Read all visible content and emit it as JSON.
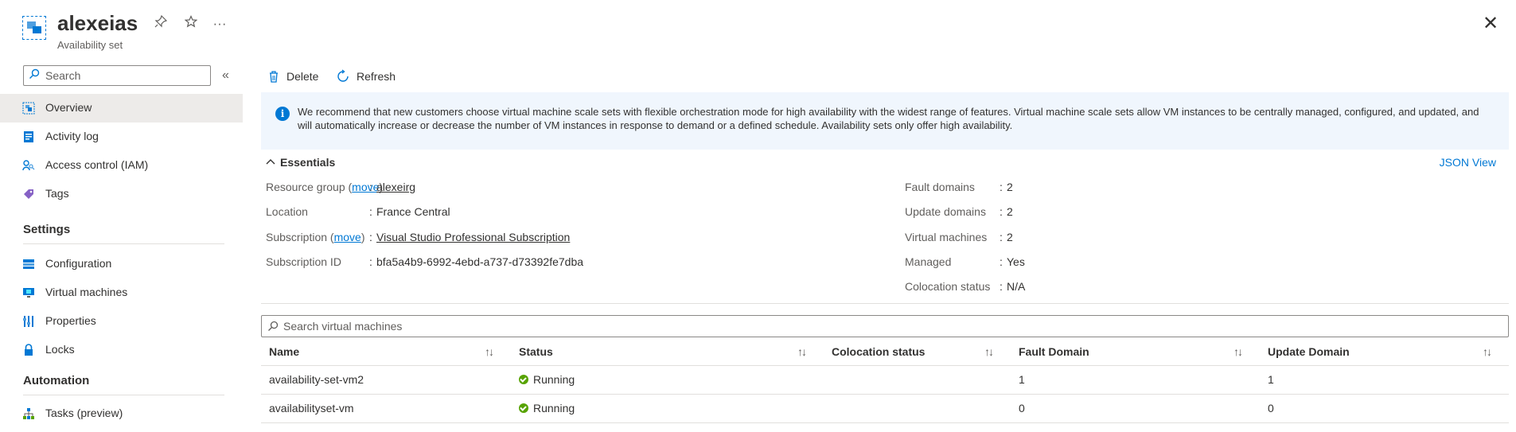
{
  "header": {
    "title": "alexeias",
    "subtitle": "Availability set",
    "pin_icon": "pin-icon",
    "favorite_icon": "star-icon",
    "more_label": "···",
    "close_label": "✕"
  },
  "sidebar": {
    "search_placeholder": "Search",
    "collapse_label": "«",
    "items": [
      {
        "label": "Overview",
        "icon": "overview-icon"
      },
      {
        "label": "Activity log",
        "icon": "activity-log-icon"
      },
      {
        "label": "Access control (IAM)",
        "icon": "iam-icon"
      },
      {
        "label": "Tags",
        "icon": "tag-icon"
      }
    ],
    "settings_header": "Settings",
    "settings_items": [
      {
        "label": "Configuration",
        "icon": "configuration-icon"
      },
      {
        "label": "Virtual machines",
        "icon": "virtual-machine-icon"
      },
      {
        "label": "Properties",
        "icon": "properties-icon"
      },
      {
        "label": "Locks",
        "icon": "lock-icon"
      }
    ],
    "automation_header": "Automation",
    "automation_items": [
      {
        "label": "Tasks (preview)",
        "icon": "tasks-icon"
      }
    ]
  },
  "toolbar": {
    "delete_label": "Delete",
    "refresh_label": "Refresh"
  },
  "banner": {
    "text": "We recommend that new customers choose virtual machine scale sets with flexible orchestration mode for high availability with the widest range of features. Virtual machine scale sets allow VM instances to be centrally managed, configured, and updated, and will automatically increase or decrease the number of VM instances in response to demand or a defined schedule. Availability sets only offer high availability."
  },
  "essentials": {
    "toggle_label": "Essentials",
    "json_view_label": "JSON View",
    "move_label": "move",
    "left": {
      "resource_group_label": "Resource group (",
      "resource_group_label_end": ")",
      "resource_group_value": "alexeirg",
      "location_label": "Location",
      "location_value": "France Central",
      "subscription_label": "Subscription (",
      "subscription_label_end": ")",
      "subscription_value": "Visual Studio Professional Subscription",
      "subscription_id_label": "Subscription ID",
      "subscription_id_value": "bfa5a4b9-6992-4ebd-a737-d73392fe7dba"
    },
    "right": {
      "fault_domains_label": "Fault domains",
      "fault_domains_value": "2",
      "update_domains_label": "Update domains",
      "update_domains_value": "2",
      "virtual_machines_label": "Virtual machines",
      "virtual_machines_value": "2",
      "managed_label": "Managed",
      "managed_value": "Yes",
      "colocation_label": "Colocation status",
      "colocation_value": "N/A"
    },
    "separator": ":"
  },
  "vm_search": {
    "placeholder": "Search virtual machines"
  },
  "table": {
    "sort_label": "↑↓",
    "columns": [
      "Name",
      "Status",
      "Colocation status",
      "Fault Domain",
      "Update Domain"
    ],
    "rows": [
      {
        "name": "availability-set-vm2",
        "status": "Running",
        "colocation": "",
        "fault_domain": "1",
        "update_domain": "1"
      },
      {
        "name": "availabilityset-vm",
        "status": "Running",
        "colocation": "",
        "fault_domain": "0",
        "update_domain": "0"
      }
    ]
  },
  "colors": {
    "accent": "#0078d4",
    "running": "#57a300",
    "banner_bg": "#f0f6fd",
    "active_nav_bg": "#edebe9"
  }
}
